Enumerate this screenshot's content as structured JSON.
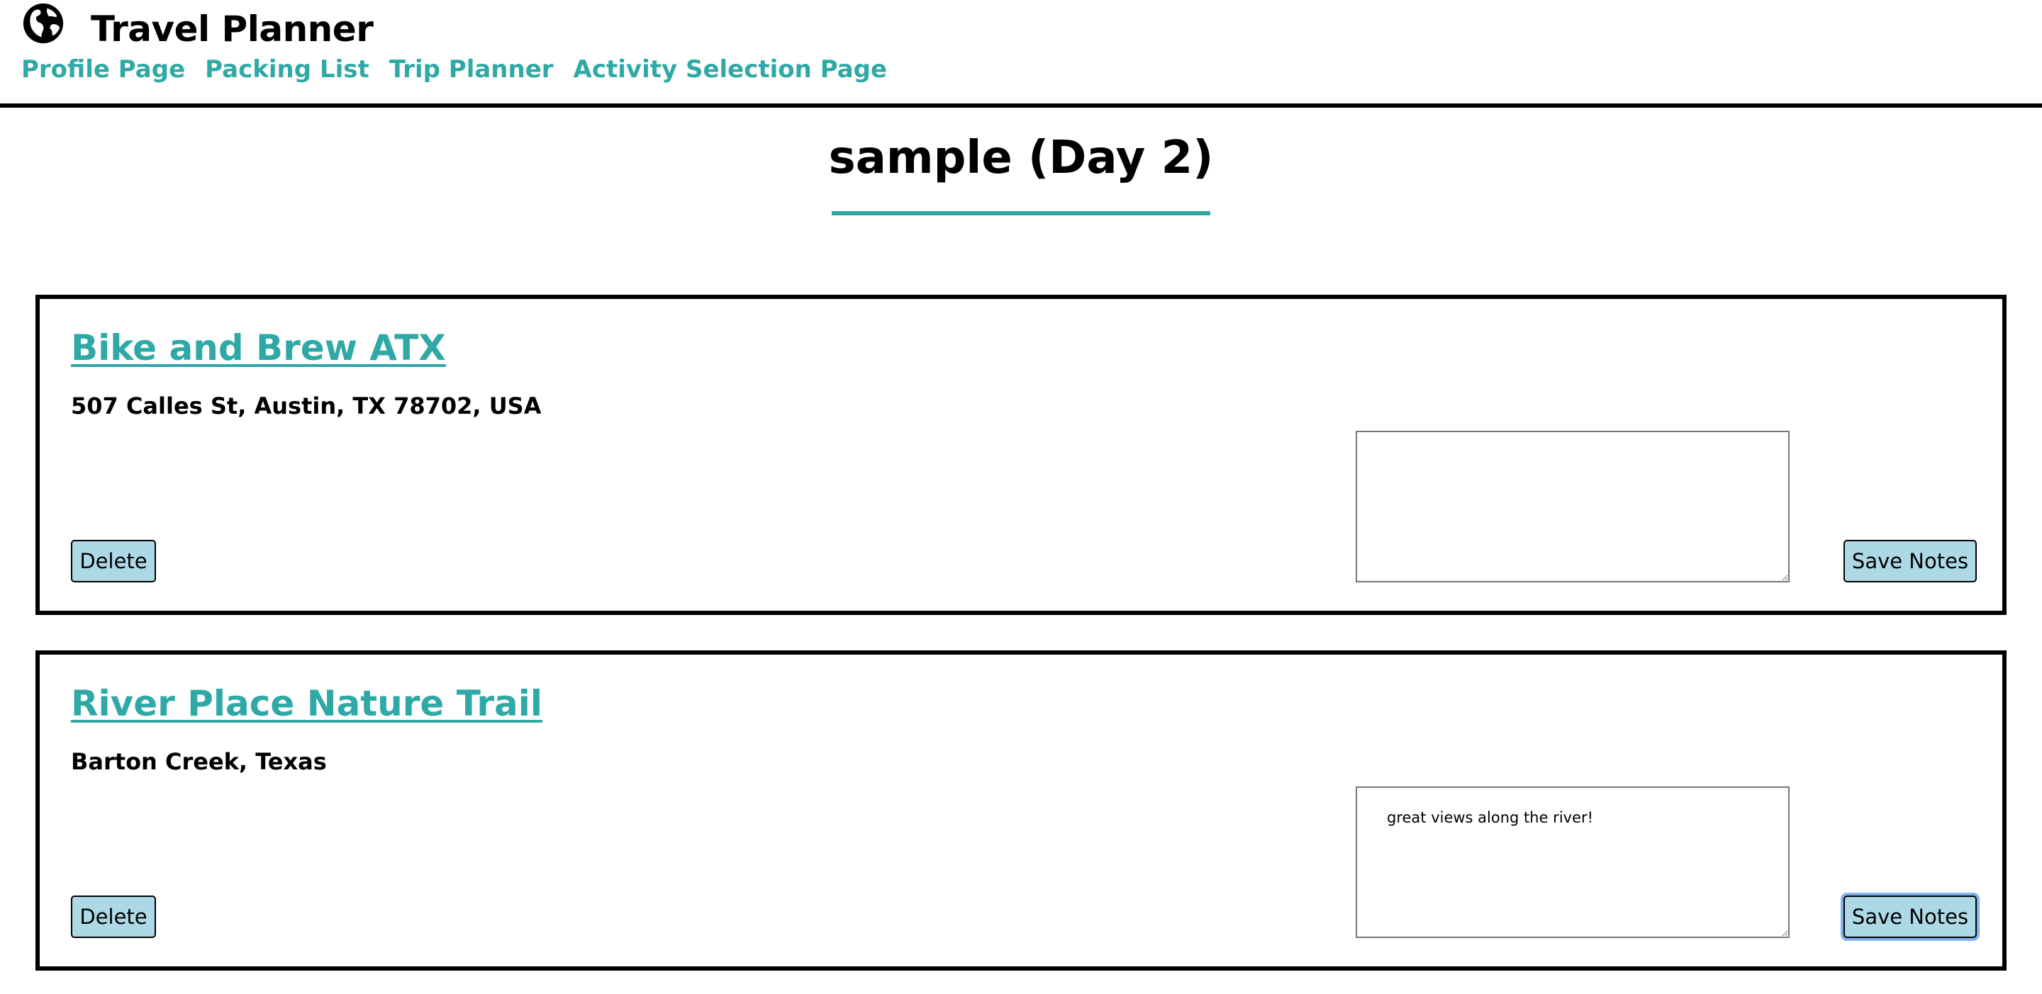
{
  "app": {
    "title": "Travel Planner",
    "logo_icon": "globe-icon"
  },
  "nav": {
    "items": [
      {
        "label": "Profile Page"
      },
      {
        "label": "Packing List"
      },
      {
        "label": "Trip Planner"
      },
      {
        "label": "Activity Selection Page"
      }
    ]
  },
  "page": {
    "title": "sample (Day 2)"
  },
  "colors": {
    "accent": "#2fa9a6",
    "button_bg": "#add8e6",
    "focus_ring": "#7fb3f0"
  },
  "activities": [
    {
      "name": "Bike and Brew ATX",
      "address": "507 Calles St, Austin, TX 78702, USA",
      "notes": "",
      "delete_label": "Delete",
      "save_label": "Save Notes"
    },
    {
      "name": "River Place Nature Trail",
      "address": "Barton Creek, Texas",
      "notes": "great views along the river!",
      "delete_label": "Delete",
      "save_label": "Save Notes"
    }
  ]
}
